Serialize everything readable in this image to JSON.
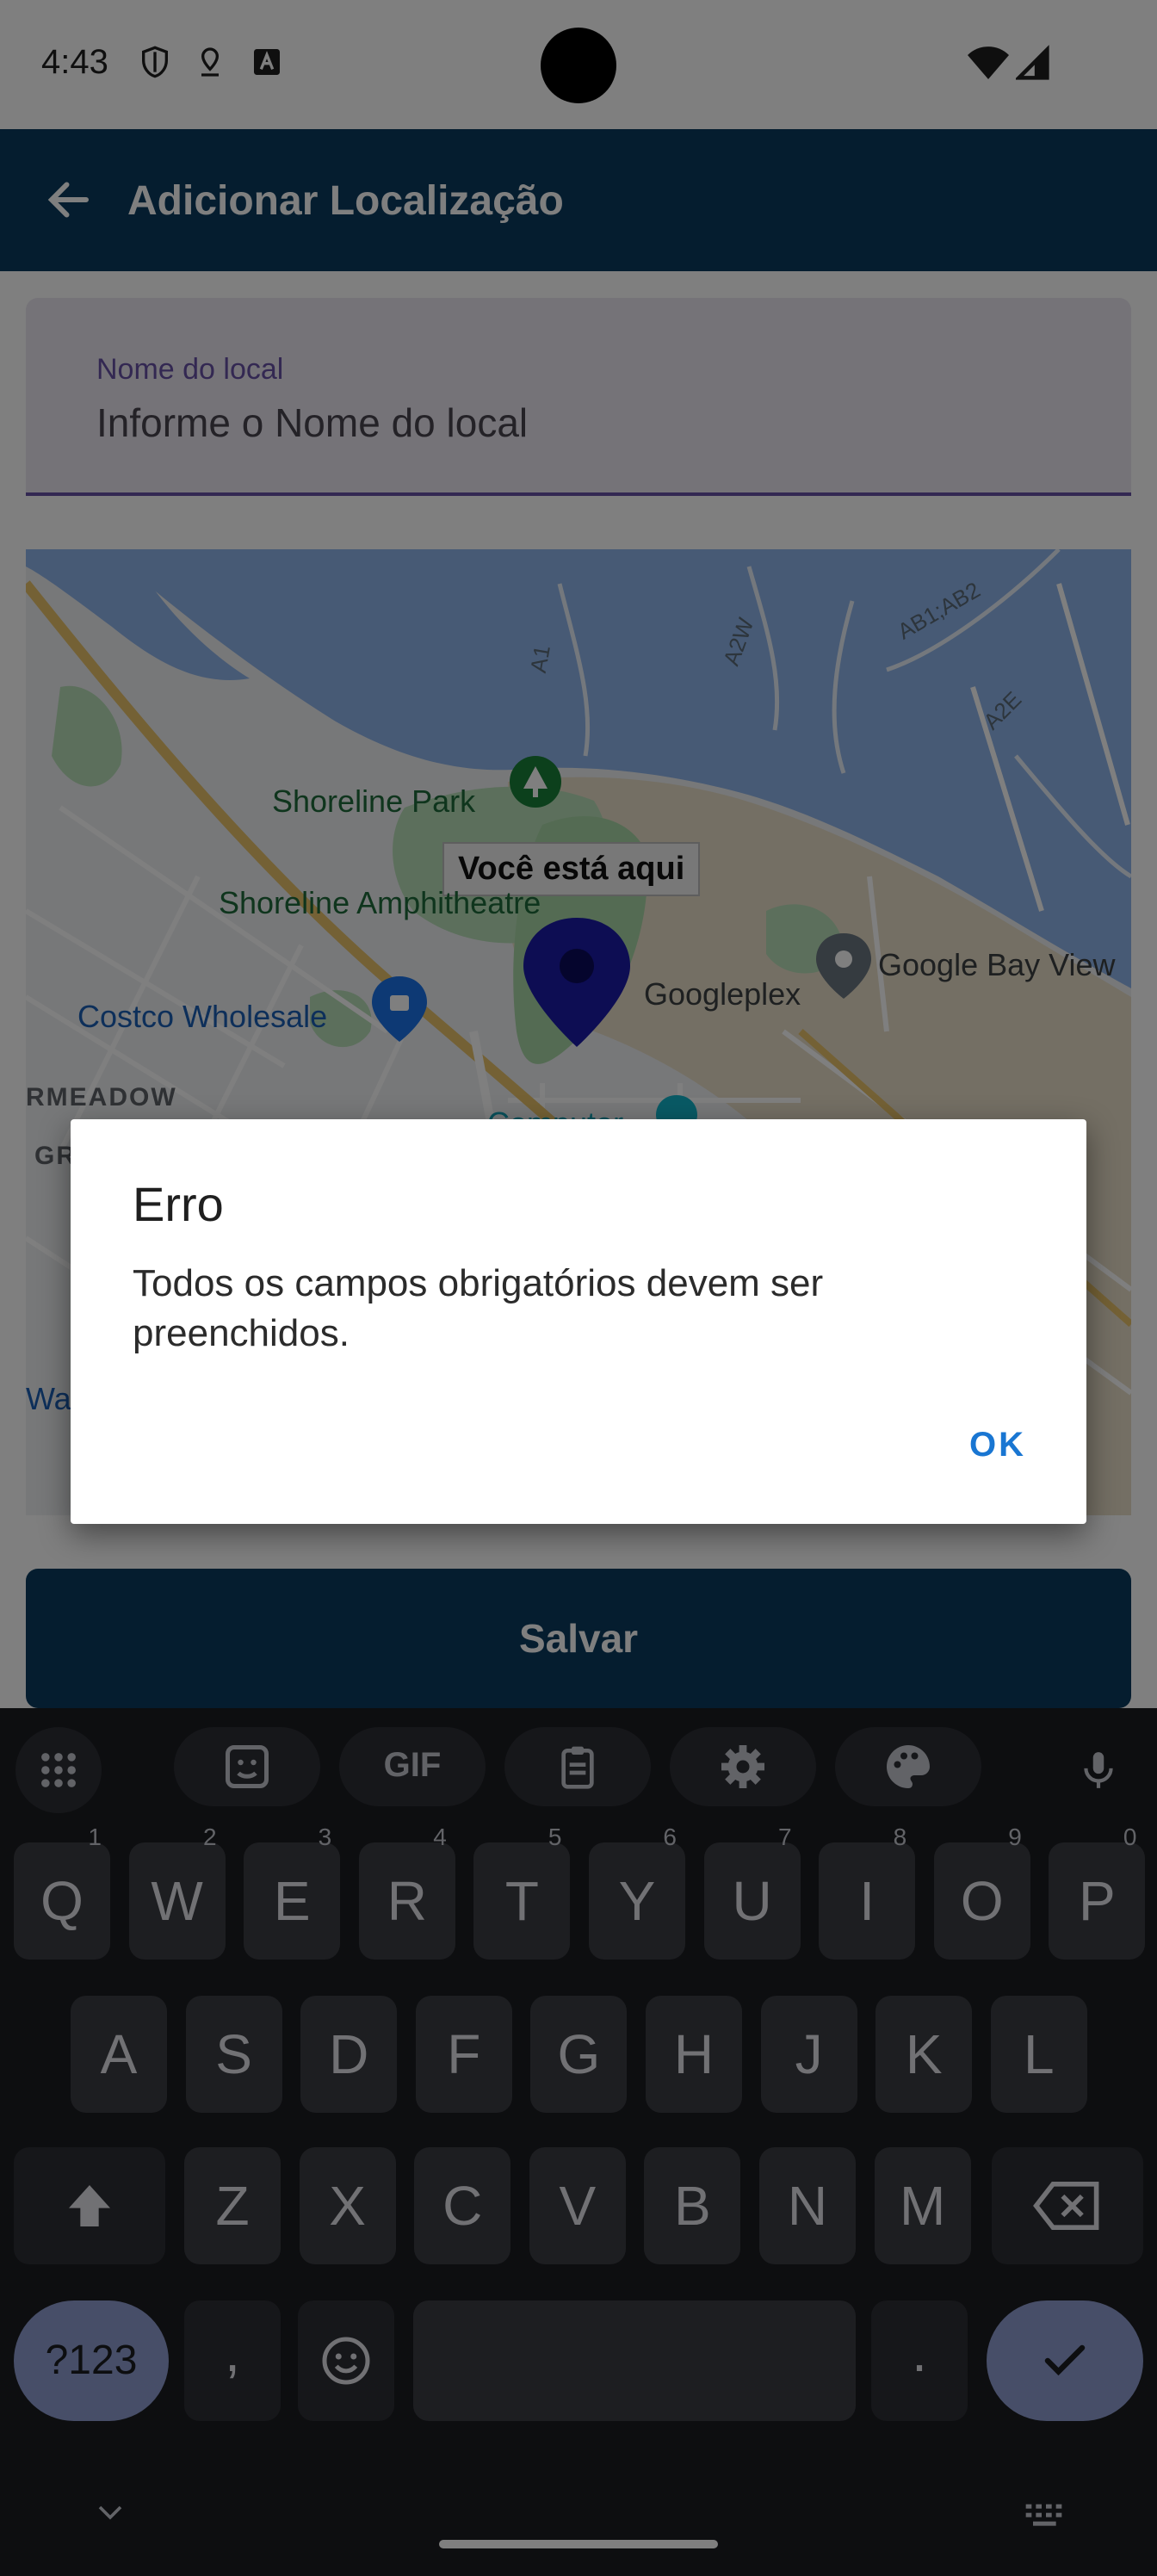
{
  "status_bar": {
    "time": "4:43"
  },
  "app_bar": {
    "title": "Adicionar Localização"
  },
  "form": {
    "name_label": "Nome do local",
    "name_placeholder": "Informe o Nome do local",
    "name_value": ""
  },
  "map": {
    "you_are_here": "Você está aqui",
    "places": {
      "shoreline_park": "Shoreline Park",
      "amphitheatre": "Shoreline Amphitheatre",
      "googleplex": "Googleplex",
      "google_bay_view": "Google Bay View",
      "costco": "Costco Wholesale",
      "rmeadow": "RMEADOW",
      "computer": "Computer",
      "wa": "Wa",
      "gr": "GR"
    },
    "roads": {
      "a1": "A1",
      "a2w": "A2W",
      "ab1ab2": "AB1;AB2",
      "a2e": "A2E"
    }
  },
  "save_button": {
    "label": "Salvar"
  },
  "dialog": {
    "title": "Erro",
    "message": "Todos os campos obrigatórios devem ser preenchidos.",
    "ok_label": "OK"
  },
  "keyboard": {
    "gif_label": "GIF",
    "row1": [
      {
        "k": "Q",
        "h": "1"
      },
      {
        "k": "W",
        "h": "2"
      },
      {
        "k": "E",
        "h": "3"
      },
      {
        "k": "R",
        "h": "4"
      },
      {
        "k": "T",
        "h": "5"
      },
      {
        "k": "Y",
        "h": "6"
      },
      {
        "k": "U",
        "h": "7"
      },
      {
        "k": "I",
        "h": "8"
      },
      {
        "k": "O",
        "h": "9"
      },
      {
        "k": "P",
        "h": "0"
      }
    ],
    "row2": [
      "A",
      "S",
      "D",
      "F",
      "G",
      "H",
      "J",
      "K",
      "L"
    ],
    "row3": [
      "Z",
      "X",
      "C",
      "V",
      "B",
      "N",
      "M"
    ],
    "symbols_label": "?123",
    "comma_label": ",",
    "period_label": "."
  },
  "colors": {
    "app_bar": "#0b3a5e",
    "accent": "#6750a4",
    "dialog_button": "#1976d2",
    "map_pin": "#1a1aa6"
  }
}
